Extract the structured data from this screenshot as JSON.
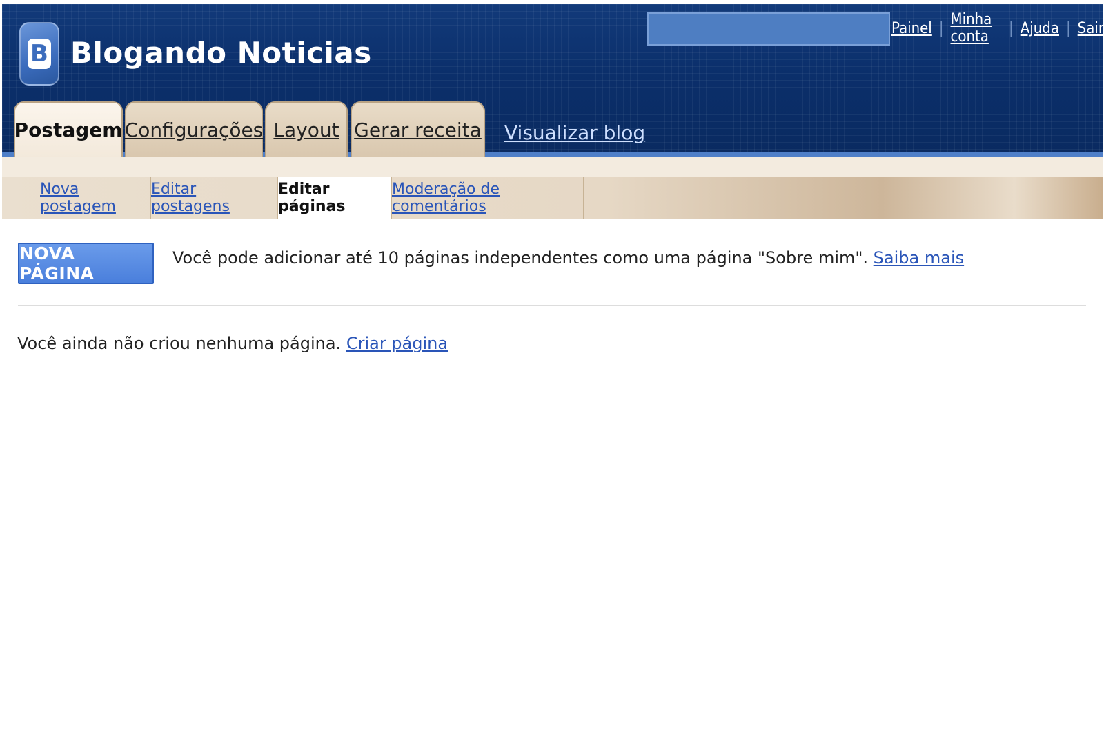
{
  "header": {
    "blog_title": "Blogando Noticias",
    "top_links": [
      "Painel",
      "Minha conta",
      "Ajuda",
      "Sair"
    ]
  },
  "tabs": [
    {
      "label": "Postagem",
      "active": true
    },
    {
      "label": "Configurações",
      "active": false
    },
    {
      "label": "Layout",
      "active": false
    },
    {
      "label": "Gerar receita",
      "active": false
    }
  ],
  "view_blog_label": "Visualizar blog",
  "subtabs": [
    {
      "label": "Nova postagem",
      "active": false
    },
    {
      "label": "Editar postagens",
      "active": false
    },
    {
      "label": "Editar páginas",
      "active": true
    },
    {
      "label": "Moderação de comentários",
      "active": false
    }
  ],
  "content": {
    "new_page_button": "NOVA PÁGINA",
    "info_text": "Você pode adicionar até 10 páginas independentes como uma página \"Sobre mim\". ",
    "info_link": "Saiba mais",
    "empty_text": "Você ainda não criou nenhuma página. ",
    "empty_link": "Criar página"
  },
  "colors": {
    "header_bg": "#0b2f6b",
    "tab_bg": "#e3d3bc",
    "link": "#2a55b8",
    "button": "#4a7fdc"
  }
}
